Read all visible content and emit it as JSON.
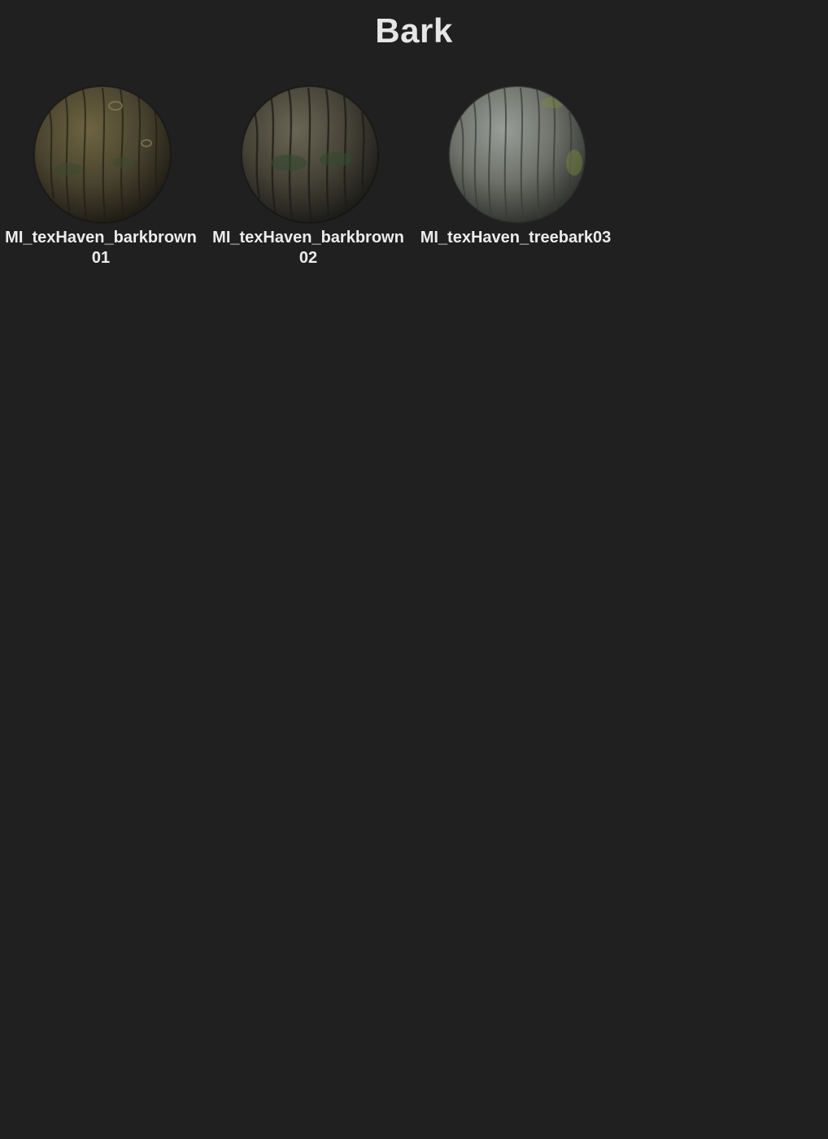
{
  "page": {
    "title": "Bark"
  },
  "materials": [
    {
      "name": "MI_texHaven_barkbrown01",
      "preview_icon": "sphere-preview-icon",
      "colors": {
        "light": "#6e6440",
        "mid": "#4a4430",
        "dark": "#1e1c14",
        "accent": "#3c4a2c"
      }
    },
    {
      "name": "MI_texHaven_barkbrown02",
      "preview_icon": "sphere-preview-icon",
      "colors": {
        "light": "#6a6656",
        "mid": "#454236",
        "dark": "#1c1c18",
        "accent": "#344a30"
      }
    },
    {
      "name": "MI_texHaven_treebark03",
      "preview_icon": "sphere-preview-icon",
      "colors": {
        "light": "#9a9e9a",
        "mid": "#6c7068",
        "dark": "#30322e",
        "accent": "#7a8a40"
      }
    }
  ],
  "theme": {
    "background": "#202020",
    "text": "#ececec"
  }
}
